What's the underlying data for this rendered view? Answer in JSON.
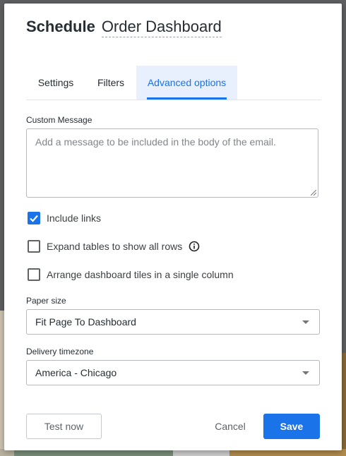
{
  "dialog": {
    "title_label": "Schedule",
    "title_name": "Order Dashboard"
  },
  "tabs": [
    {
      "label": "Settings",
      "active": false
    },
    {
      "label": "Filters",
      "active": false
    },
    {
      "label": "Advanced options",
      "active": true
    }
  ],
  "custom_message": {
    "label": "Custom Message",
    "value": "",
    "placeholder": "Add a message to be included in the body of the email."
  },
  "options": [
    {
      "label": "Include links",
      "checked": true
    },
    {
      "label": "Expand tables to show all rows",
      "checked": false,
      "has_info": true
    },
    {
      "label": "Arrange dashboard tiles in a single column",
      "checked": false
    }
  ],
  "paper_size": {
    "label": "Paper size",
    "value": "Fit Page To Dashboard"
  },
  "delivery_timezone": {
    "label": "Delivery timezone",
    "value": "America - Chicago"
  },
  "buttons": {
    "test_now": "Test now",
    "cancel": "Cancel",
    "save": "Save"
  },
  "colors": {
    "accent": "#1a73e8",
    "active_tab_bg": "#e8f0fe",
    "text": "#262d33"
  }
}
